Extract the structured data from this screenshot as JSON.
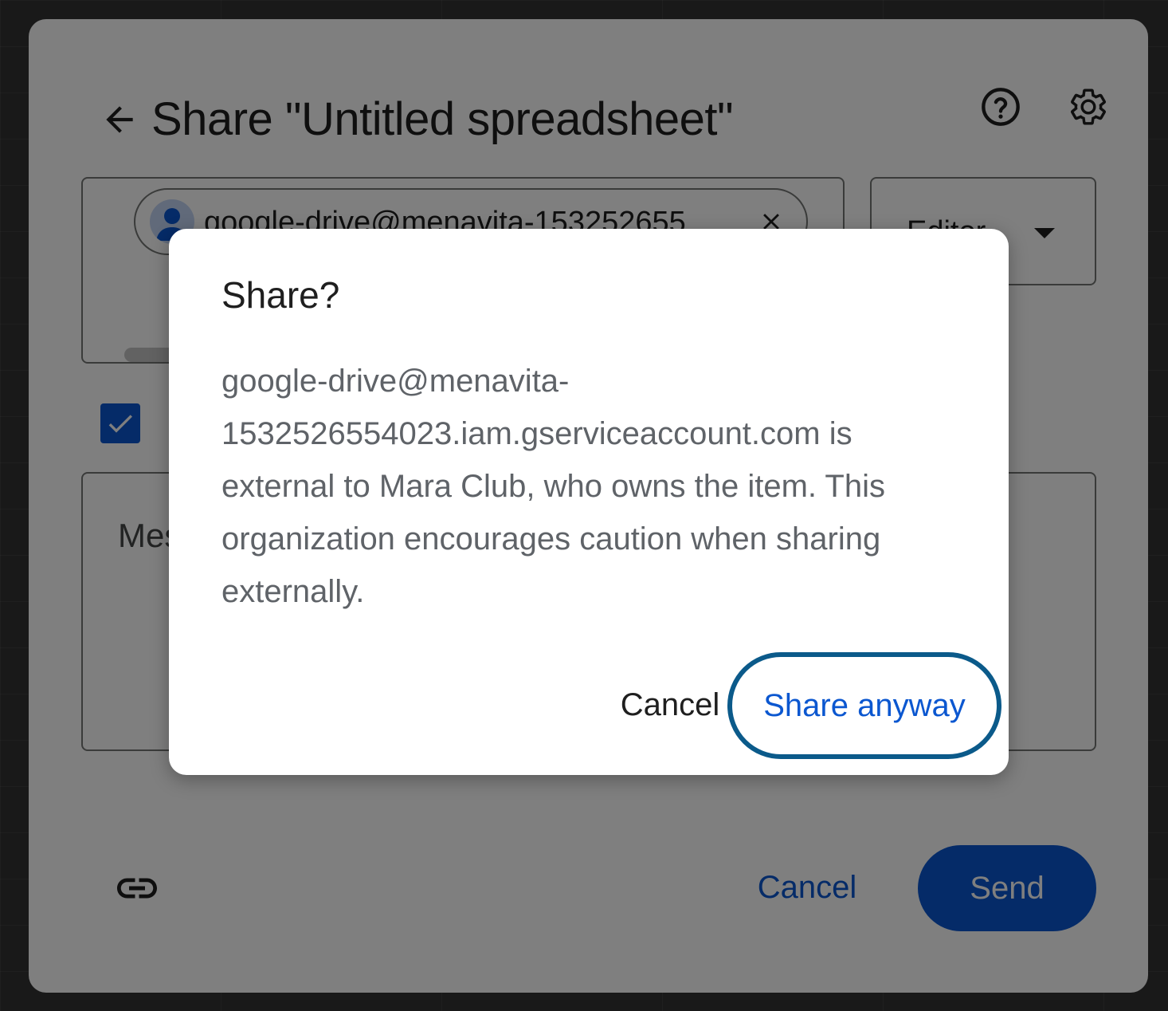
{
  "share_dialog": {
    "title": "Share \"Untitled spreadsheet\"",
    "back_icon": "arrow-back-icon",
    "help_icon": "help-icon",
    "settings_icon": "gear-icon",
    "recipient_chip": {
      "email": "google-drive@menavita-153252655",
      "avatar_icon": "person-icon",
      "remove_icon": "close-icon"
    },
    "role": {
      "selected": "Editor"
    },
    "notify_checkbox": {
      "checked": true
    },
    "message": {
      "placeholder": "Message"
    },
    "copy_link_icon": "link-icon",
    "cancel_label": "Cancel",
    "send_label": "Send"
  },
  "confirm_dialog": {
    "title": "Share?",
    "body": "google-drive@menavita-1532526554023.iam.gserviceaccount.com is external to Mara Club, who owns the item. This organization encourages caution when sharing externally.",
    "cancel_label": "Cancel",
    "share_anyway_label": "Share anyway"
  },
  "colors": {
    "accent": "#0b57d0",
    "focus_ring": "#0b5a8a",
    "scrim": "rgba(0,0,0,0.5)"
  }
}
